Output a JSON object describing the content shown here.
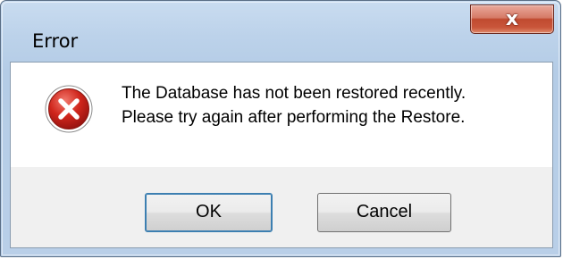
{
  "window": {
    "title": "Error"
  },
  "title_bar": {
    "close_glyph": "x"
  },
  "dialog": {
    "icon": "error-icon",
    "message_lines": [
      "The Database has not been restored recently.",
      "Please try again after performing the Restore."
    ]
  },
  "buttons": {
    "ok_label": "OK",
    "cancel_label": "Cancel"
  },
  "colors": {
    "frame": "#b9cfe8",
    "close_button": "#c9563a",
    "error_icon": "#c8201a",
    "client_background": "#f0f0f0",
    "message_background": "#ffffff"
  }
}
